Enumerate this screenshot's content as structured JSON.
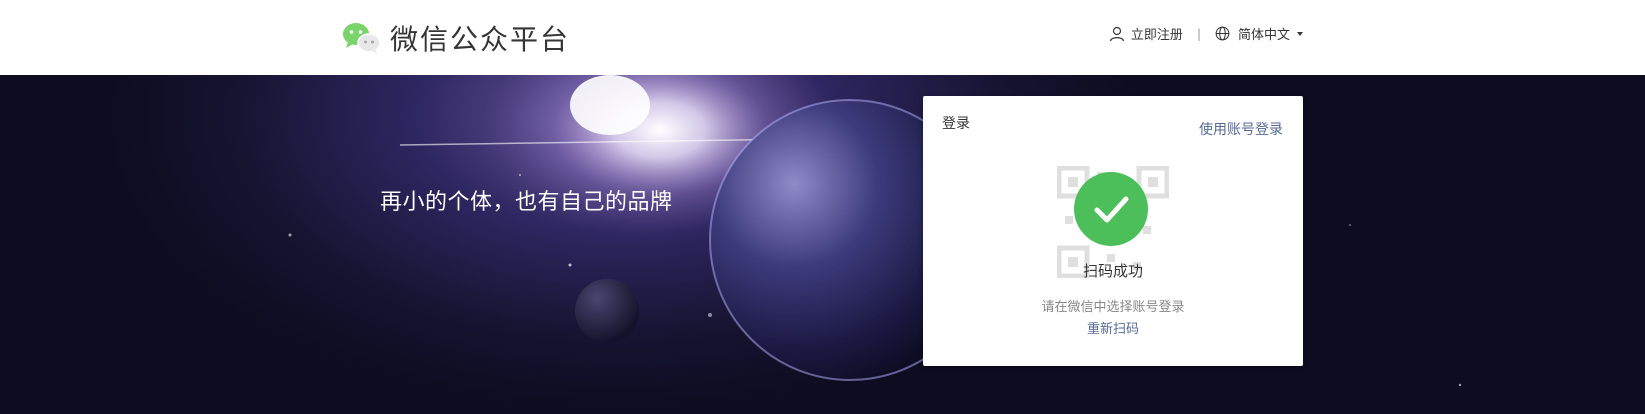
{
  "header": {
    "title": "微信公众平台",
    "register_label": "立即注册",
    "separator": "|",
    "language_label": "简体中文"
  },
  "banner": {
    "slogan": "再小的个体，也有自己的品牌"
  },
  "login": {
    "title": "登录",
    "account_login_link": "使用账号登录",
    "status": "扫码成功",
    "hint": "请在微信中选择账号登录",
    "rescan_link": "重新扫码"
  },
  "colors": {
    "accent": "#4cbf5b",
    "link": "#576b95",
    "text": "#353535"
  },
  "icons": [
    "wechat-logo-icon",
    "user-icon",
    "globe-icon",
    "chevron-down-icon",
    "check-icon",
    "qr-code-icon"
  ]
}
